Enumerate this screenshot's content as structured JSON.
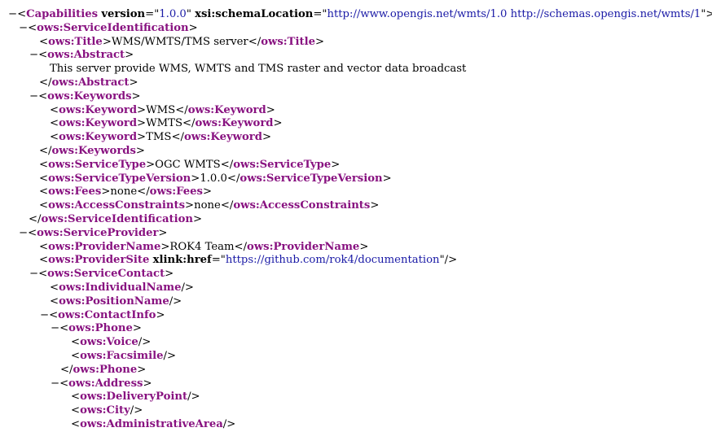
{
  "colors": {
    "tag": "#881280",
    "attr_name": "#000000",
    "attr_value": "#1a1aa6",
    "text": "#000000",
    "background": "#ffffff"
  },
  "toggle_symbol": "−",
  "lines": [
    {
      "depth": 0,
      "toggle": true,
      "kind": "open",
      "tag": "Capabilities",
      "attrs": [
        {
          "name": "version",
          "value": "1.0.0"
        },
        {
          "name": "xsi:schemaLocation",
          "value": "http://www.opengis.net/wmts/1.0 http://schemas.opengis.net/wmts/1"
        }
      ]
    },
    {
      "depth": 1,
      "toggle": true,
      "kind": "open",
      "tag": "ows:ServiceIdentification"
    },
    {
      "depth": 2,
      "toggle": false,
      "kind": "inline",
      "tag": "ows:Title",
      "text": "WMS/WMTS/TMS server"
    },
    {
      "depth": 2,
      "toggle": true,
      "kind": "open",
      "tag": "ows:Abstract"
    },
    {
      "depth": 3,
      "toggle": false,
      "kind": "text",
      "text": "This server provide WMS, WMTS and TMS raster and vector data broadcast"
    },
    {
      "depth": 2,
      "toggle": false,
      "kind": "close",
      "tag": "ows:Abstract"
    },
    {
      "depth": 2,
      "toggle": true,
      "kind": "open",
      "tag": "ows:Keywords"
    },
    {
      "depth": 3,
      "toggle": false,
      "kind": "inline",
      "tag": "ows:Keyword",
      "text": "WMS"
    },
    {
      "depth": 3,
      "toggle": false,
      "kind": "inline",
      "tag": "ows:Keyword",
      "text": "WMTS"
    },
    {
      "depth": 3,
      "toggle": false,
      "kind": "inline",
      "tag": "ows:Keyword",
      "text": "TMS"
    },
    {
      "depth": 2,
      "toggle": false,
      "kind": "close",
      "tag": "ows:Keywords"
    },
    {
      "depth": 2,
      "toggle": false,
      "kind": "inline",
      "tag": "ows:ServiceType",
      "text": "OGC WMTS"
    },
    {
      "depth": 2,
      "toggle": false,
      "kind": "inline",
      "tag": "ows:ServiceTypeVersion",
      "text": "1.0.0"
    },
    {
      "depth": 2,
      "toggle": false,
      "kind": "inline",
      "tag": "ows:Fees",
      "text": "none"
    },
    {
      "depth": 2,
      "toggle": false,
      "kind": "inline",
      "tag": "ows:AccessConstraints",
      "text": "none"
    },
    {
      "depth": 1,
      "toggle": false,
      "kind": "close",
      "tag": "ows:ServiceIdentification"
    },
    {
      "depth": 1,
      "toggle": true,
      "kind": "open",
      "tag": "ows:ServiceProvider"
    },
    {
      "depth": 2,
      "toggle": false,
      "kind": "inline",
      "tag": "ows:ProviderName",
      "text": "ROK4 Team"
    },
    {
      "depth": 2,
      "toggle": false,
      "kind": "empty",
      "tag": "ows:ProviderSite",
      "attrs": [
        {
          "name": "xlink:href",
          "value": "https://github.com/rok4/documentation"
        }
      ]
    },
    {
      "depth": 2,
      "toggle": true,
      "kind": "open",
      "tag": "ows:ServiceContact"
    },
    {
      "depth": 3,
      "toggle": false,
      "kind": "empty",
      "tag": "ows:IndividualName"
    },
    {
      "depth": 3,
      "toggle": false,
      "kind": "empty",
      "tag": "ows:PositionName"
    },
    {
      "depth": 3,
      "toggle": true,
      "kind": "open",
      "tag": "ows:ContactInfo"
    },
    {
      "depth": 4,
      "toggle": true,
      "kind": "open",
      "tag": "ows:Phone"
    },
    {
      "depth": 5,
      "toggle": false,
      "kind": "empty",
      "tag": "ows:Voice"
    },
    {
      "depth": 5,
      "toggle": false,
      "kind": "empty",
      "tag": "ows:Facsimile"
    },
    {
      "depth": 4,
      "toggle": false,
      "kind": "close",
      "tag": "ows:Phone"
    },
    {
      "depth": 4,
      "toggle": true,
      "kind": "open",
      "tag": "ows:Address"
    },
    {
      "depth": 5,
      "toggle": false,
      "kind": "empty",
      "tag": "ows:DeliveryPoint"
    },
    {
      "depth": 5,
      "toggle": false,
      "kind": "empty",
      "tag": "ows:City"
    },
    {
      "depth": 5,
      "toggle": false,
      "kind": "empty",
      "tag": "ows:AdministrativeArea"
    }
  ]
}
